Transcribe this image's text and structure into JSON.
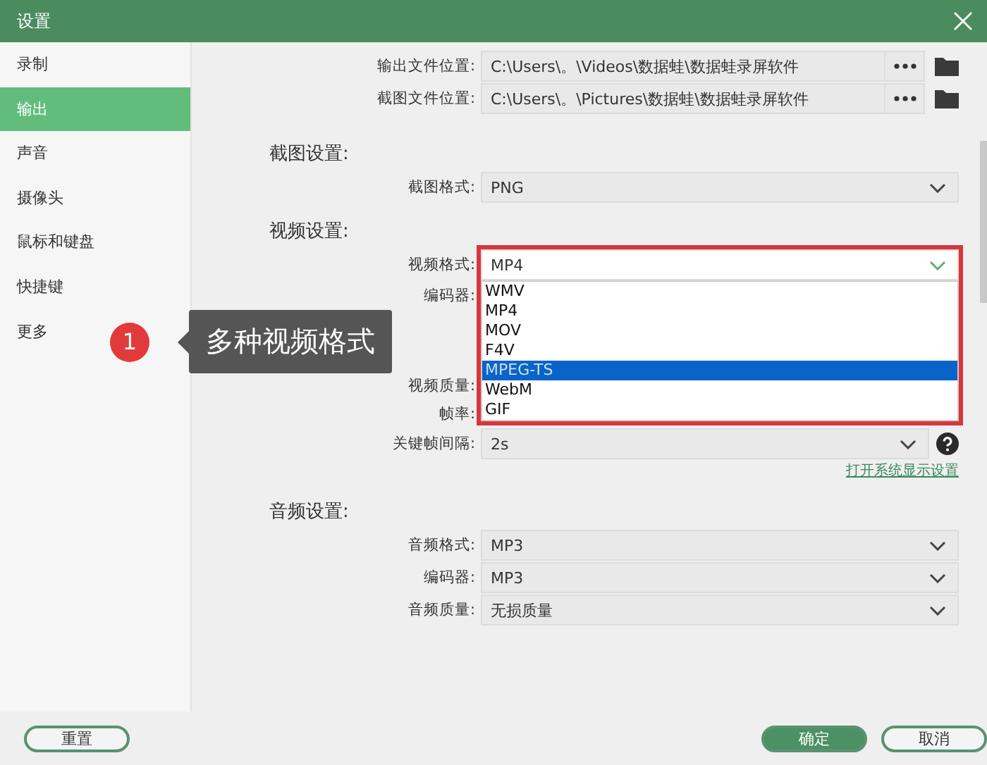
{
  "window": {
    "title": "设置"
  },
  "sidebar": {
    "items": [
      {
        "label": "录制",
        "selected": false
      },
      {
        "label": "输出",
        "selected": true
      },
      {
        "label": "声音",
        "selected": false
      },
      {
        "label": "摄像头",
        "selected": false
      },
      {
        "label": "鼠标和键盘",
        "selected": false
      },
      {
        "label": "快捷键",
        "selected": false
      },
      {
        "label": "更多",
        "selected": false
      }
    ]
  },
  "paths": [
    {
      "label": "输出文件位置:",
      "value": "C:\\Users\\。\\Videos\\数据蛙\\数据蛙录屏软件"
    },
    {
      "label": "截图文件位置:",
      "value": "C:\\Users\\。\\Pictures\\数据蛙\\数据蛙录屏软件"
    }
  ],
  "sections": [
    {
      "heading": "截图设置:",
      "rows": [
        {
          "kind": "select",
          "label": "截图格式:",
          "value": "PNG"
        }
      ]
    },
    {
      "heading": "视频设置:",
      "rows": [
        {
          "kind": "dropdown",
          "label": "视频格式:",
          "value": "MP4",
          "open": true,
          "options": [
            {
              "label": "WMV",
              "highlighted": false
            },
            {
              "label": "MP4",
              "highlighted": false
            },
            {
              "label": "MOV",
              "highlighted": false
            },
            {
              "label": "F4V",
              "highlighted": false
            },
            {
              "label": "MPEG-TS",
              "highlighted": true
            },
            {
              "label": "WebM",
              "highlighted": false
            },
            {
              "label": "GIF",
              "highlighted": false
            }
          ]
        },
        {
          "kind": "covered",
          "label": "编码器:"
        },
        {
          "kind": "gap"
        },
        {
          "kind": "covered",
          "label": "视频质量:"
        },
        {
          "kind": "covered",
          "label": "帧率:"
        },
        {
          "kind": "select",
          "label": "关键帧间隔:",
          "value": "2s",
          "help": true
        },
        {
          "kind": "link",
          "label": "打开系统显示设置"
        }
      ]
    },
    {
      "heading": "音频设置:",
      "rows": [
        {
          "kind": "select",
          "label": "音频格式:",
          "value": "MP3"
        },
        {
          "kind": "select",
          "label": "编码器:",
          "value": "MP3"
        },
        {
          "kind": "select",
          "label": "音频质量:",
          "value": "无损质量"
        }
      ]
    }
  ],
  "callout": {
    "number": "1",
    "text": "多种视频格式"
  },
  "buttons": {
    "reset": "重置",
    "ok": "确定",
    "cancel": "取消"
  }
}
